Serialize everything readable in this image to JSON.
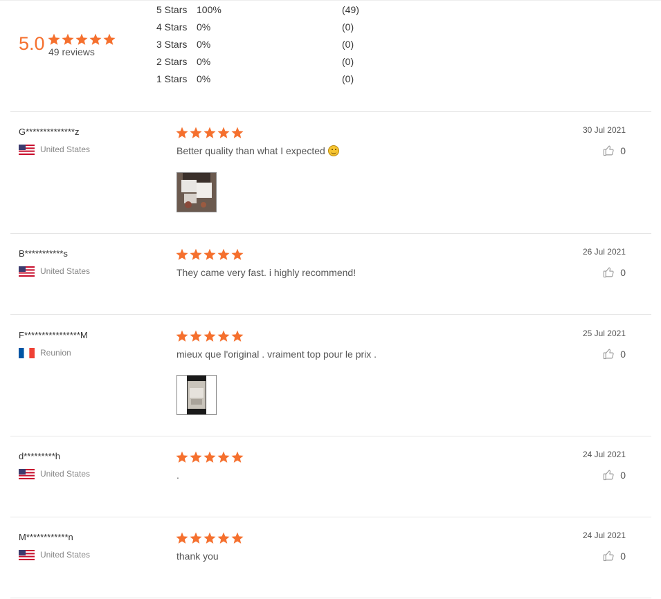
{
  "summary": {
    "average": "5.0",
    "average_stars": 5,
    "total_label": "49 reviews",
    "breakdown": [
      {
        "label": "5  Stars",
        "percent": "100%",
        "count": "(49)"
      },
      {
        "label": "4  Stars",
        "percent": "0%",
        "count": "(0)"
      },
      {
        "label": "3  Stars",
        "percent": "0%",
        "count": "(0)"
      },
      {
        "label": "2  Stars",
        "percent": "0%",
        "count": "(0)"
      },
      {
        "label": "1  Stars",
        "percent": "0%",
        "count": "(0)"
      }
    ]
  },
  "colors": {
    "star": "#f5702e",
    "accent": "#f5702e"
  },
  "reviews": [
    {
      "name": "G**************z",
      "country": "United States",
      "flag": "us-flag",
      "stars": 5,
      "text": "Better quality than what I expected",
      "emoji": "smiling-face-icon",
      "date": "30 Jul 2021",
      "likes": "0",
      "has_photo": true
    },
    {
      "name": "B***********s",
      "country": "United States",
      "flag": "us-flag",
      "stars": 5,
      "text": "They came very fast. i highly recommend!",
      "date": "26 Jul 2021",
      "likes": "0",
      "has_photo": false
    },
    {
      "name": "F****************M",
      "country": "Reunion",
      "flag": "fr-flag",
      "stars": 5,
      "text": "mieux que l'original . vraiment top pour le prix .",
      "date": "25 Jul 2021",
      "likes": "0",
      "has_photo": true
    },
    {
      "name": "d*********h",
      "country": "United States",
      "flag": "us-flag",
      "stars": 5,
      "text": ".",
      "date": "24 Jul 2021",
      "likes": "0",
      "has_photo": false
    },
    {
      "name": "M************n",
      "country": "United States",
      "flag": "us-flag",
      "stars": 5,
      "text": "thank you",
      "date": "24 Jul 2021",
      "likes": "0",
      "has_photo": false
    }
  ]
}
